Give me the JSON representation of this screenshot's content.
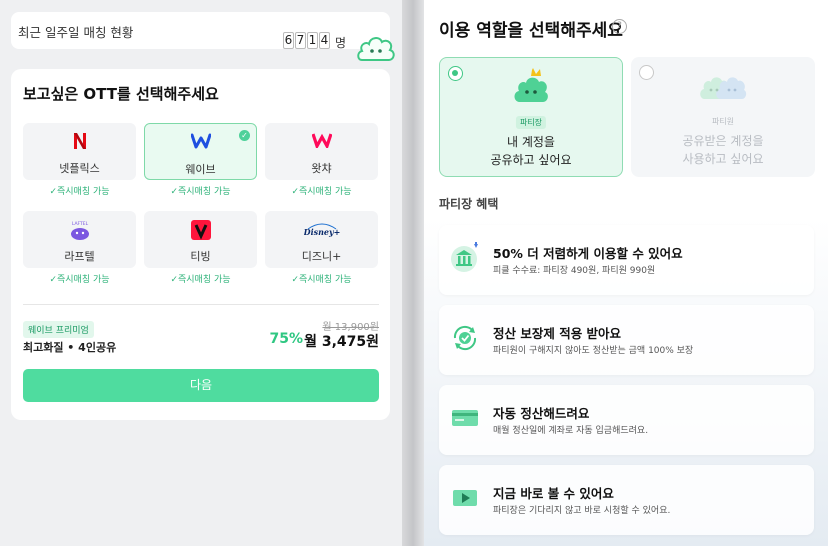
{
  "left": {
    "stats": {
      "label": "최근 일주일 매칭 현황",
      "digits": [
        "6",
        "7",
        "1",
        "4"
      ],
      "unit": "명"
    },
    "title": "보고싶은 OTT를 선택해주세요",
    "services": [
      {
        "name": "넷플릭스",
        "tag": "✓즉시매칭 가능",
        "icon": "netflix-logo",
        "color": "#e50914",
        "selected": false
      },
      {
        "name": "웨이브",
        "tag": "✓즉시매칭 가능",
        "icon": "wavve-logo",
        "color": "#1f4fe0",
        "selected": true
      },
      {
        "name": "왓챠",
        "tag": "✓즉시매칭 가능",
        "icon": "watcha-logo",
        "color": "#ff0a5a",
        "selected": false
      },
      {
        "name": "라프텔",
        "tag": "✓즉시매칭 가능",
        "icon": "laftel-logo",
        "color": "#7b57e0",
        "selected": false
      },
      {
        "name": "티빙",
        "tag": "✓즉시매칭 가능",
        "icon": "tving-logo",
        "color": "#ff153c",
        "selected": false
      },
      {
        "name": "디즈니+",
        "tag": "✓즉시매칭 가능",
        "icon": "disney-plus-logo",
        "color": "#0a2a6b",
        "selected": false
      }
    ],
    "laftel_logo_text": "LAFTEL",
    "disney_logo_text": "Disney+",
    "plan": {
      "badge": "웨이브 프리미엄",
      "description": "최고화질 • 4인공유",
      "original_price": "월 13,900원",
      "discount": "75%",
      "price": "월 3,475원"
    },
    "next_button": "다음"
  },
  "right": {
    "title": "이용 역할을 선택해주세요",
    "help_icon": "?",
    "roles": [
      {
        "tag": "파티장",
        "line1": "내 계정을",
        "line2": "공유하고 싶어요",
        "selected": true
      },
      {
        "tag": "파티원",
        "line1": "공유받은 계정을",
        "line2": "사용하고 싶어요",
        "selected": false
      }
    ],
    "benefits_heading": "파티장 혜택",
    "benefits": [
      {
        "title": "50% 더 저렴하게 이용할 수 있어요",
        "desc": "피클 수수료: 파티장 490원, 파티원 990원",
        "icon": "bank-icon"
      },
      {
        "title": "정산 보장제 적용 받아요",
        "desc": "파티원이 구해지지 않아도 정산받는 금액 100% 보장",
        "icon": "refresh-shield-icon"
      },
      {
        "title": "자동 정산해드려요",
        "desc": "매월 정산일에 계좌로 자동 입금해드려요.",
        "icon": "card-icon"
      },
      {
        "title": "지금 바로 볼 수 있어요",
        "desc": "파티장은 기다리지 않고 바로 시청할 수 있어요.",
        "icon": "play-icon"
      }
    ],
    "accent_color": "#4fdc9f"
  }
}
